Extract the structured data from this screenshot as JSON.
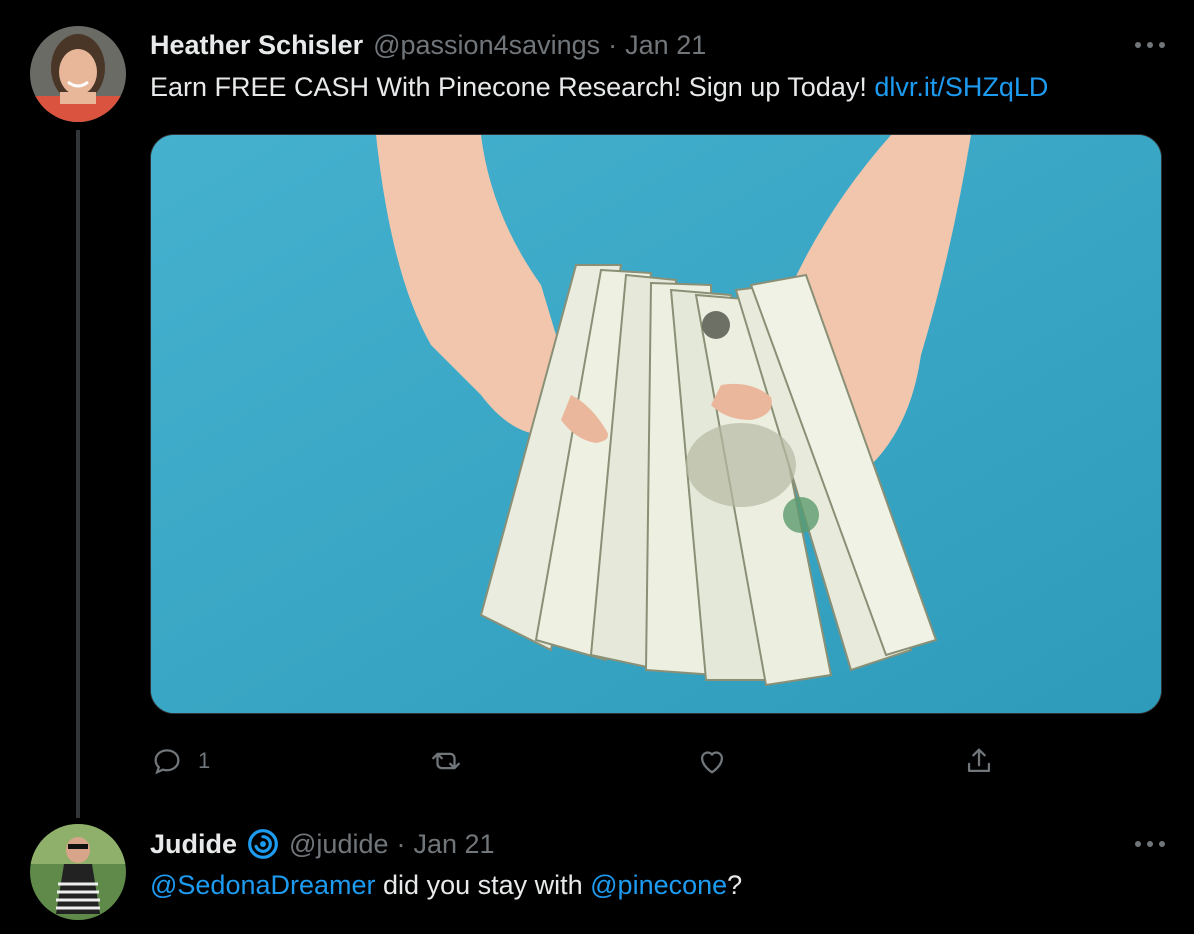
{
  "tweets": [
    {
      "author": {
        "name": "Heather Schisler",
        "handle": "@passion4savings"
      },
      "separator": "·",
      "date": "Jan 21",
      "text": {
        "plain": "Earn FREE CASH With Pinecone Research! Sign up Today! ",
        "link": "dlvr.it/SHZqLD"
      },
      "media": {
        "description_icon": "photo",
        "accent": "#3eaac8"
      },
      "actions": {
        "reply_count": "1",
        "retweet_count": "",
        "like_count": ""
      }
    },
    {
      "author": {
        "name": "Judide",
        "handle": "@judide",
        "badge_icon": "circle-swirl-icon"
      },
      "separator": "·",
      "date": "Jan 21",
      "text": {
        "mention1": "@SedonaDreamer",
        "middle": " did you stay with ",
        "mention2": "@pinecone",
        "end": "?"
      }
    }
  ],
  "colors": {
    "link": "#1d9bf0",
    "muted": "#71767b",
    "background": "#000000"
  }
}
